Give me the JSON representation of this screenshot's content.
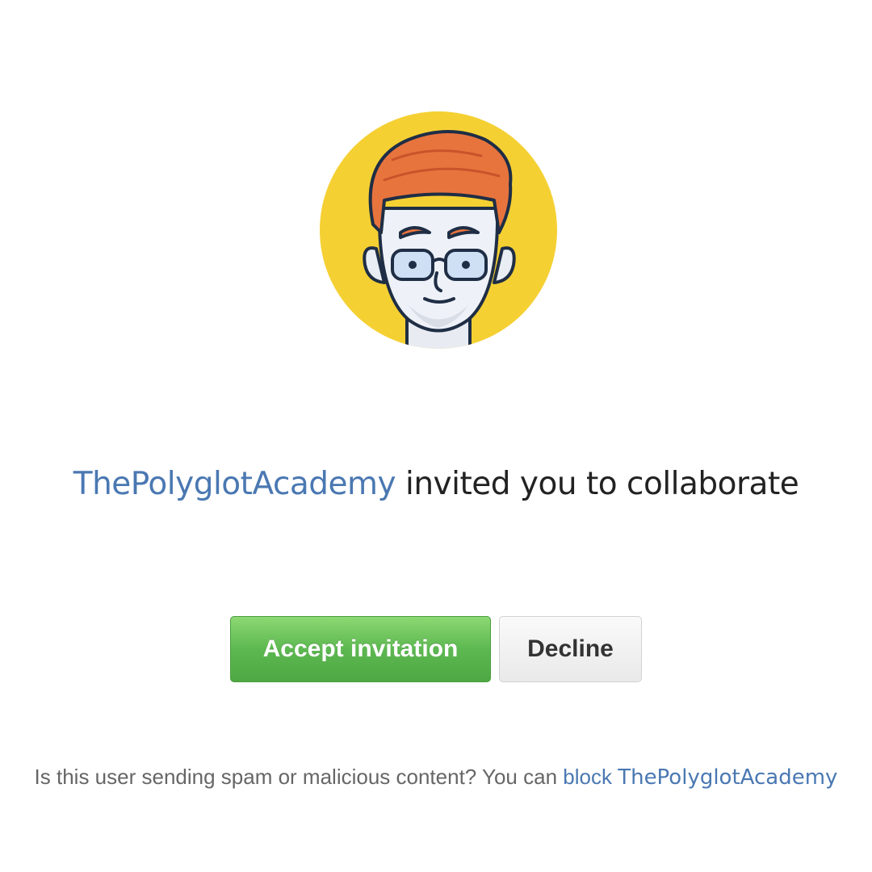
{
  "invitation": {
    "inviter": "ThePolyglotAcademy",
    "message": " invited you to collaborate"
  },
  "actions": {
    "accept_label": "Accept invitation",
    "decline_label": "Decline"
  },
  "footer": {
    "prompt": "Is this user sending spam or malicious content? You can ",
    "block_label": "block",
    "user": "ThePolyglotAcademy"
  },
  "colors": {
    "link": "#4a78b2",
    "accept_green": "#5db851",
    "avatar_background": "#f5d033",
    "hair": "#e8743d"
  },
  "icons": {
    "avatar": "cartoon-avatar-icon"
  }
}
